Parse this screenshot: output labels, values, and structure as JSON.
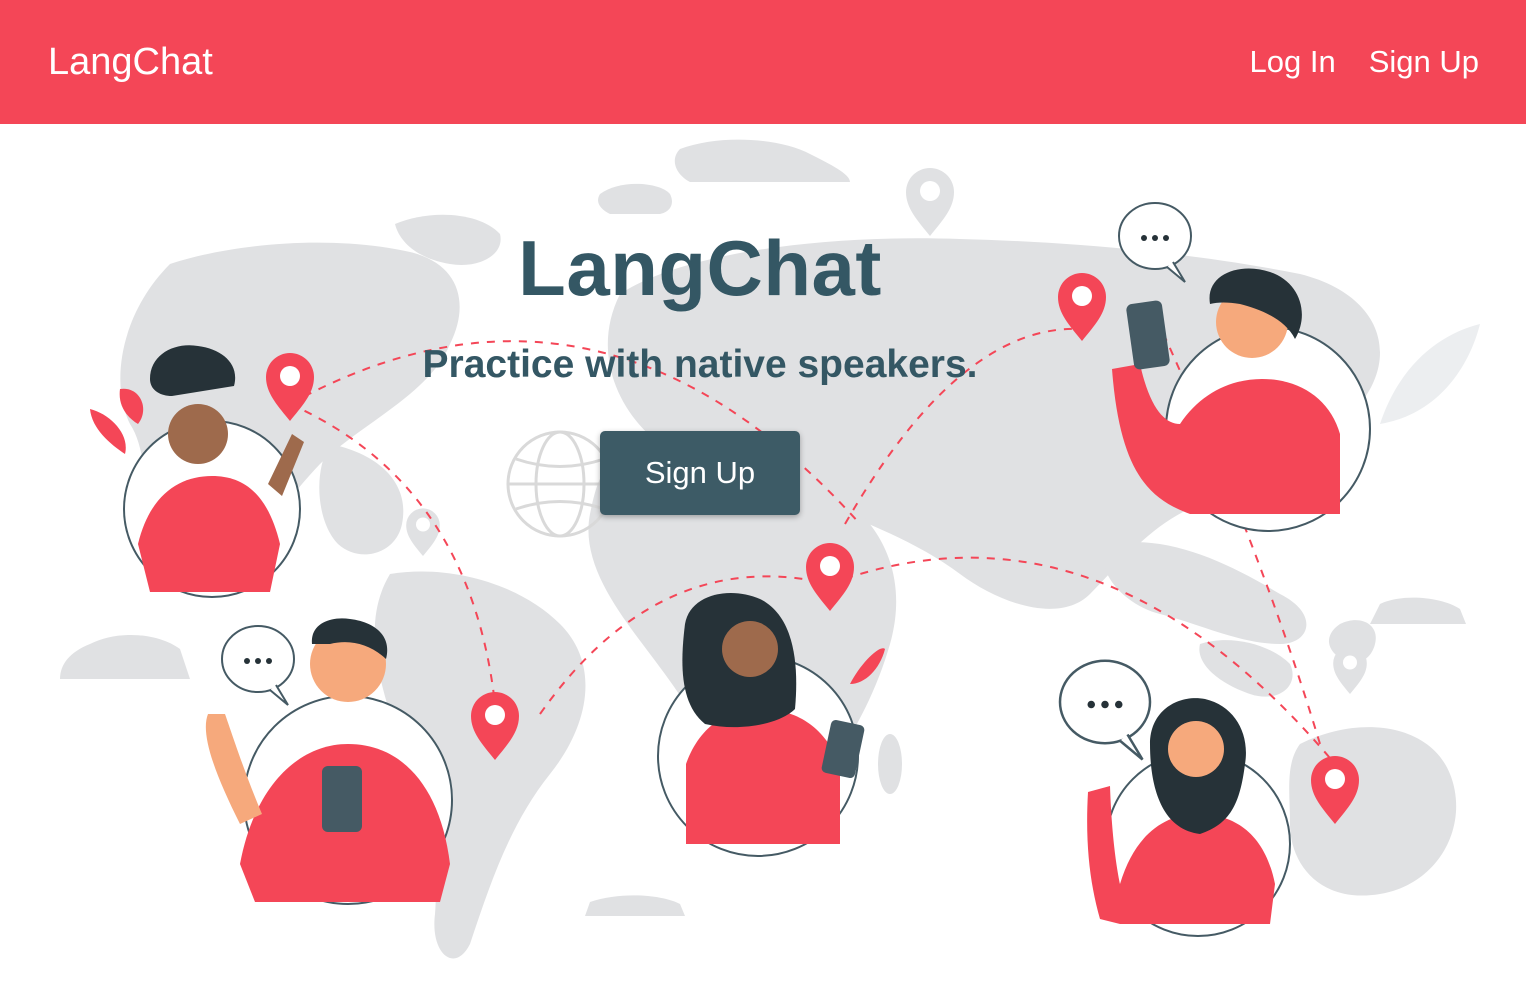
{
  "colors": {
    "brand": "#f44657",
    "text_dark": "#345764",
    "button_bg": "#3d5b66",
    "map_grey": "#e0e1e3",
    "skin_dark": "#9e6a4c",
    "skin_light": "#f6a97c",
    "hair": "#263238",
    "outline": "#455a64"
  },
  "navbar": {
    "brand": "LangChat",
    "links": [
      {
        "label": "Log In"
      },
      {
        "label": "Sign Up"
      }
    ]
  },
  "hero": {
    "title": "LangChat",
    "subtitle": "Practice with native speakers.",
    "cta": {
      "label": "Sign Up"
    }
  },
  "illustration": {
    "icons": [
      "world-map-icon",
      "location-pin-icon",
      "speech-bubble-icon",
      "globe-icon",
      "phone-icon",
      "leaf-icon"
    ]
  }
}
